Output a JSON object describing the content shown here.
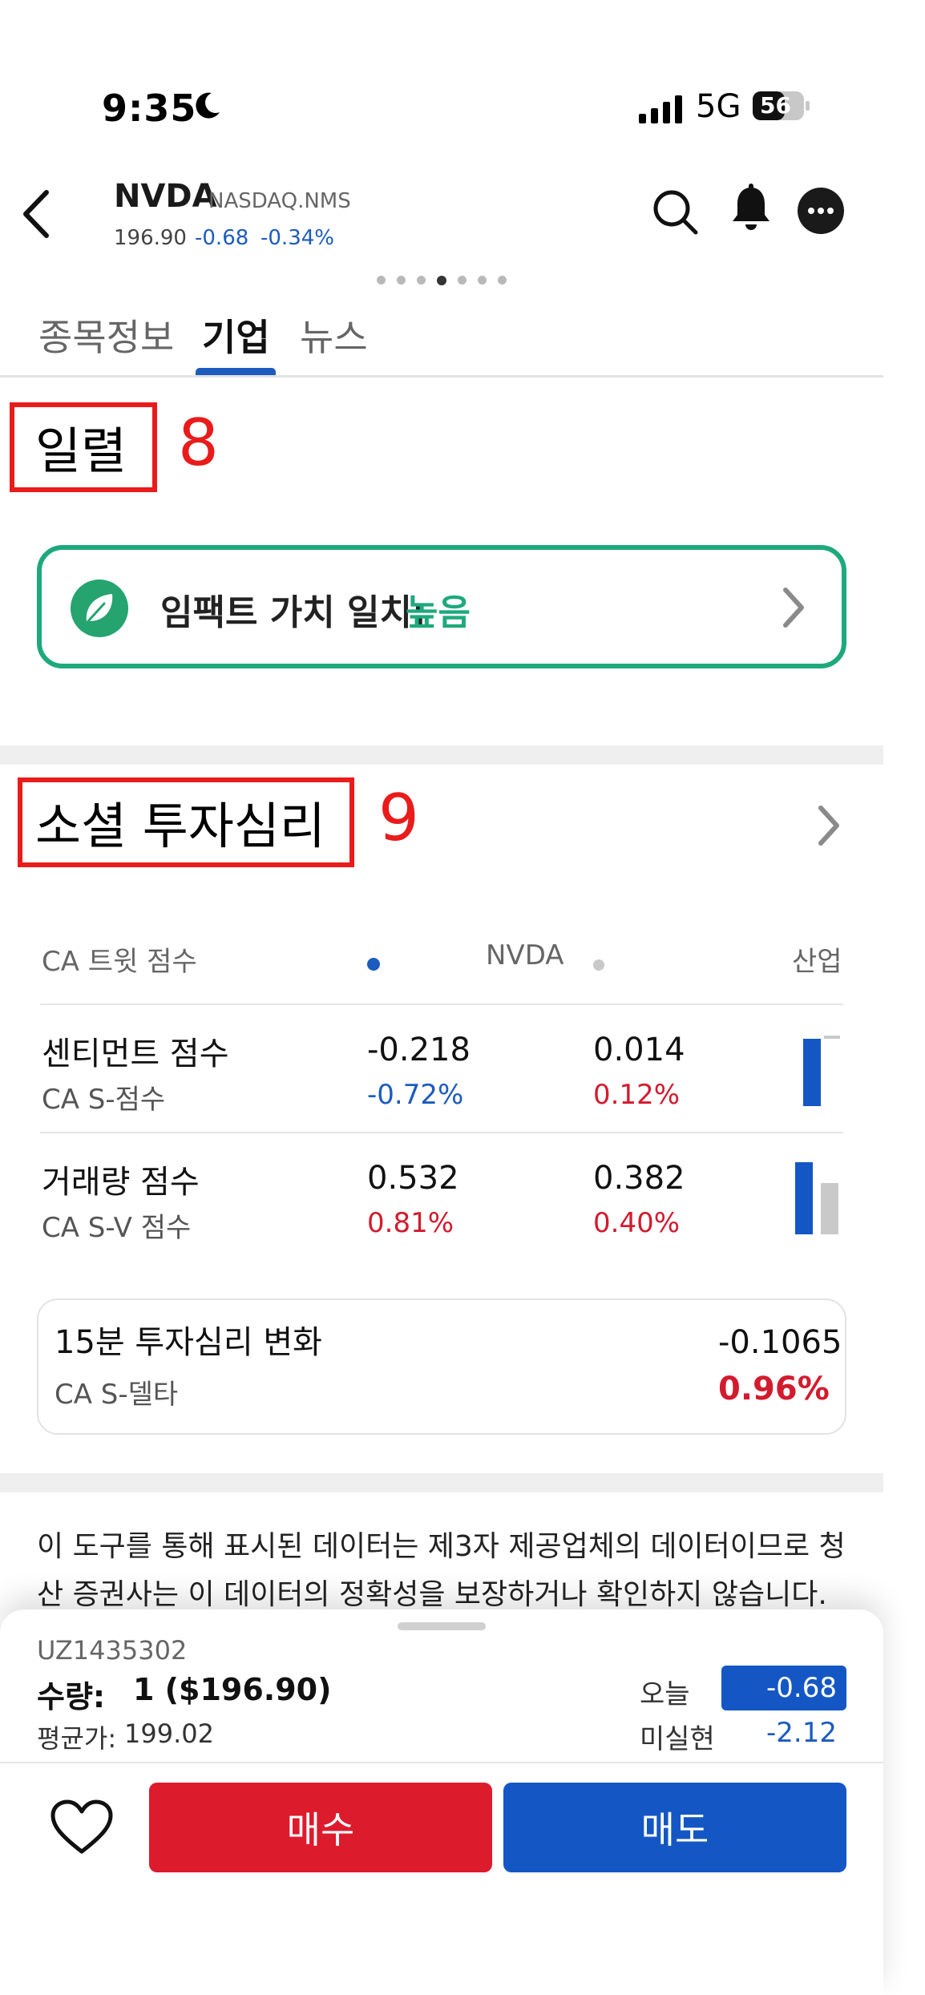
{
  "status_bar": {
    "time": "9:35",
    "network": "5G",
    "battery": "56"
  },
  "header": {
    "ticker": "NVDA",
    "exchange": "NASDAQ.NMS",
    "price": "196.90",
    "change": "-0.68",
    "change_pct": "-0.34%"
  },
  "tabs": [
    {
      "label": "종목정보",
      "active": false
    },
    {
      "label": "기업",
      "active": true
    },
    {
      "label": "뉴스",
      "active": false
    }
  ],
  "page_dots": {
    "count": 7,
    "active_index": 3
  },
  "section_history": {
    "title": "일렬",
    "annotation": "8"
  },
  "impact": {
    "label": "임팩트 가치 일치:",
    "value": "높음"
  },
  "section_social": {
    "title": "소셜 투자심리",
    "annotation": "9"
  },
  "sentiment_table": {
    "header": {
      "col1": "CA 트윗 점수",
      "col2": "NVDA",
      "col3": "산업"
    },
    "rows": [
      {
        "title": "센티먼트 점수",
        "subtitle": "CA S-점수",
        "nvda_value": "-0.218",
        "nvda_pct": "-0.72%",
        "industry_value": "0.014",
        "industry_pct": "0.12%"
      },
      {
        "title": "거래량 점수",
        "subtitle": "CA S-V 점수",
        "nvda_value": "0.532",
        "nvda_pct": "0.81%",
        "industry_value": "0.382",
        "industry_pct": "0.40%"
      }
    ]
  },
  "delta_card": {
    "title": "15분 투자심리 변화",
    "subtitle": "CA S-델타",
    "value": "-0.1065",
    "pct": "0.96%"
  },
  "disclaimer": "이 도구를 통해 표시된 데이터는 제3자 제공업체의 데이터이므로 청산 증권사는 이 데이터의 정확성을 보장하거나 확인하지 않습니다. 회사",
  "position": {
    "account": "UZ1435302",
    "qty_label": "수량:",
    "qty_value": "1 ($196.90)",
    "avg_label": "평균가:",
    "avg_value": "199.02",
    "today_label": "오늘",
    "today_value": "-0.68",
    "unrealized_label": "미실현",
    "unrealized_value": "-2.12"
  },
  "actions": {
    "buy_label": "매수",
    "sell_label": "매도"
  },
  "colors": {
    "accent_blue": "#1457c4",
    "negative_blue": "#1d5bbf",
    "positive_red": "#d31b2e",
    "buy_red": "#dc1b2d",
    "impact_green": "#1ea97c",
    "annotation_red": "#ea1b1b"
  },
  "icons": [
    "moon-icon",
    "signal-icon",
    "battery-icon",
    "back-icon",
    "search-icon",
    "bell-icon",
    "more-icon",
    "leaf-icon",
    "chevron-right-icon",
    "heart-icon"
  ]
}
